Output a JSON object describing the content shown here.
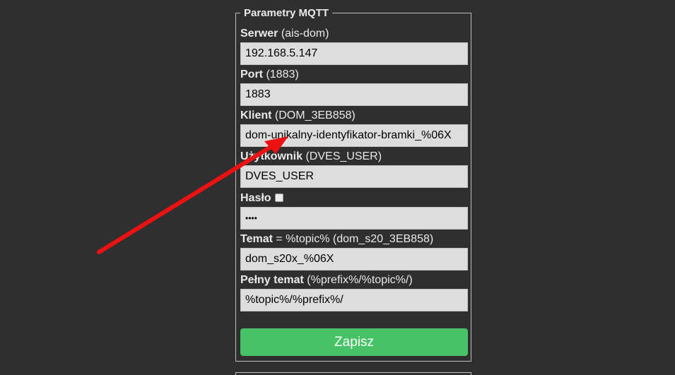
{
  "section": {
    "legend": "Parametry MQTT"
  },
  "fields": {
    "server": {
      "label": "Serwer",
      "hint": "(ais-dom)",
      "value": "192.168.5.147"
    },
    "port": {
      "label": "Port",
      "hint": "(1883)",
      "value": "1883"
    },
    "client": {
      "label": "Klient",
      "hint": "(DOM_3EB858)",
      "value": "dom-unikalny-identyfikator-bramki_%06X"
    },
    "user": {
      "label": "Użytkownik",
      "hint": "(DVES_USER)",
      "value": "DVES_USER"
    },
    "password": {
      "label": "Hasło",
      "value": "••••"
    },
    "topic": {
      "label": "Temat",
      "hint": "= %topic% (dom_s20_3EB858)",
      "value": "dom_s20x_%06X"
    },
    "full_topic": {
      "label": "Pełny temat",
      "hint": "(%prefix%/%topic%/)",
      "value": "%topic%/%prefix%/"
    }
  },
  "buttons": {
    "save_label": "Zapisz"
  },
  "colors": {
    "background": "#2f2f2f",
    "input_bg": "#dddddd",
    "save_button": "#47c266",
    "annotation_arrow": "#ee1111"
  }
}
